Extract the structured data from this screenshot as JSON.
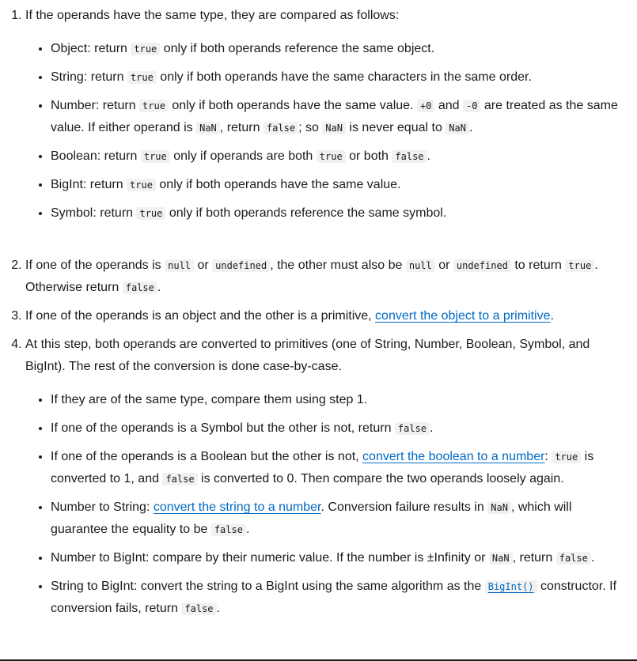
{
  "step1": {
    "intro": "If the operands have the same type, they are compared as follows:",
    "object": {
      "a": "Object: return ",
      "code": "true",
      "b": " only if both operands reference the same object."
    },
    "string": {
      "a": "String: return ",
      "code": "true",
      "b": " only if both operands have the same characters in the same order."
    },
    "number": {
      "a": "Number: return ",
      "code1": "true",
      "b": " only if both operands have the same value. ",
      "code2": "+0",
      "c": " and ",
      "code3": "-0",
      "d": " are treated as the same value. If either operand is ",
      "code4": "NaN",
      "e": ", return ",
      "code5": "false",
      "f": "; so ",
      "code6": "NaN",
      "g": " is never equal to ",
      "code7": "NaN",
      "h": "."
    },
    "boolean": {
      "a": "Boolean: return ",
      "code1": "true",
      "b": " only if operands are both ",
      "code2": "true",
      "c": " or both ",
      "code3": "false",
      "d": "."
    },
    "bigint": {
      "a": "BigInt: return ",
      "code": "true",
      "b": " only if both operands have the same value."
    },
    "symbol": {
      "a": "Symbol: return ",
      "code": "true",
      "b": " only if both operands reference the same symbol."
    }
  },
  "step2": {
    "a": "If one of the operands is ",
    "code1": "null",
    "b": " or ",
    "code2": "undefined",
    "c": ", the other must also be ",
    "code3": "null",
    "d": " or ",
    "code4": "undefined",
    "e": " to return ",
    "code5": "true",
    "f": ". Otherwise return ",
    "code6": "false",
    "g": "."
  },
  "step3": {
    "a": "If one of the operands is an object and the other is a primitive, ",
    "link": "convert the object to a primitive",
    "b": "."
  },
  "step4": {
    "intro": "At this step, both operands are converted to primitives (one of String, Number, Boolean, Symbol, and BigInt). The rest of the conversion is done case-by-case.",
    "same_type": "If they are of the same type, compare them using step 1.",
    "symbol": {
      "a": "If one of the operands is a Symbol but the other is not, return ",
      "code": "false",
      "b": "."
    },
    "boolean": {
      "a": "If one of the operands is a Boolean but the other is not, ",
      "link": "convert the boolean to a number",
      "b": ": ",
      "code1": "true",
      "c": " is converted to 1, and ",
      "code2": "false",
      "d": " is converted to 0. Then compare the two operands loosely again."
    },
    "num_string": {
      "a": "Number to String: ",
      "link": "convert the string to a number",
      "b": ". Conversion failure results in ",
      "code1": "NaN",
      "c": ", which will guarantee the equality to be ",
      "code2": "false",
      "d": "."
    },
    "num_bigint": {
      "a": "Number to BigInt: compare by their numeric value. If the number is ±Infinity or ",
      "code1": "NaN",
      "b": ", return ",
      "code2": "false",
      "c": "."
    },
    "str_bigint": {
      "a": "String to BigInt: convert the string to a BigInt using the same algorithm as the ",
      "link_code": "BigInt()",
      "b": " constructor. If conversion fails, return ",
      "code": "false",
      "c": "."
    }
  }
}
